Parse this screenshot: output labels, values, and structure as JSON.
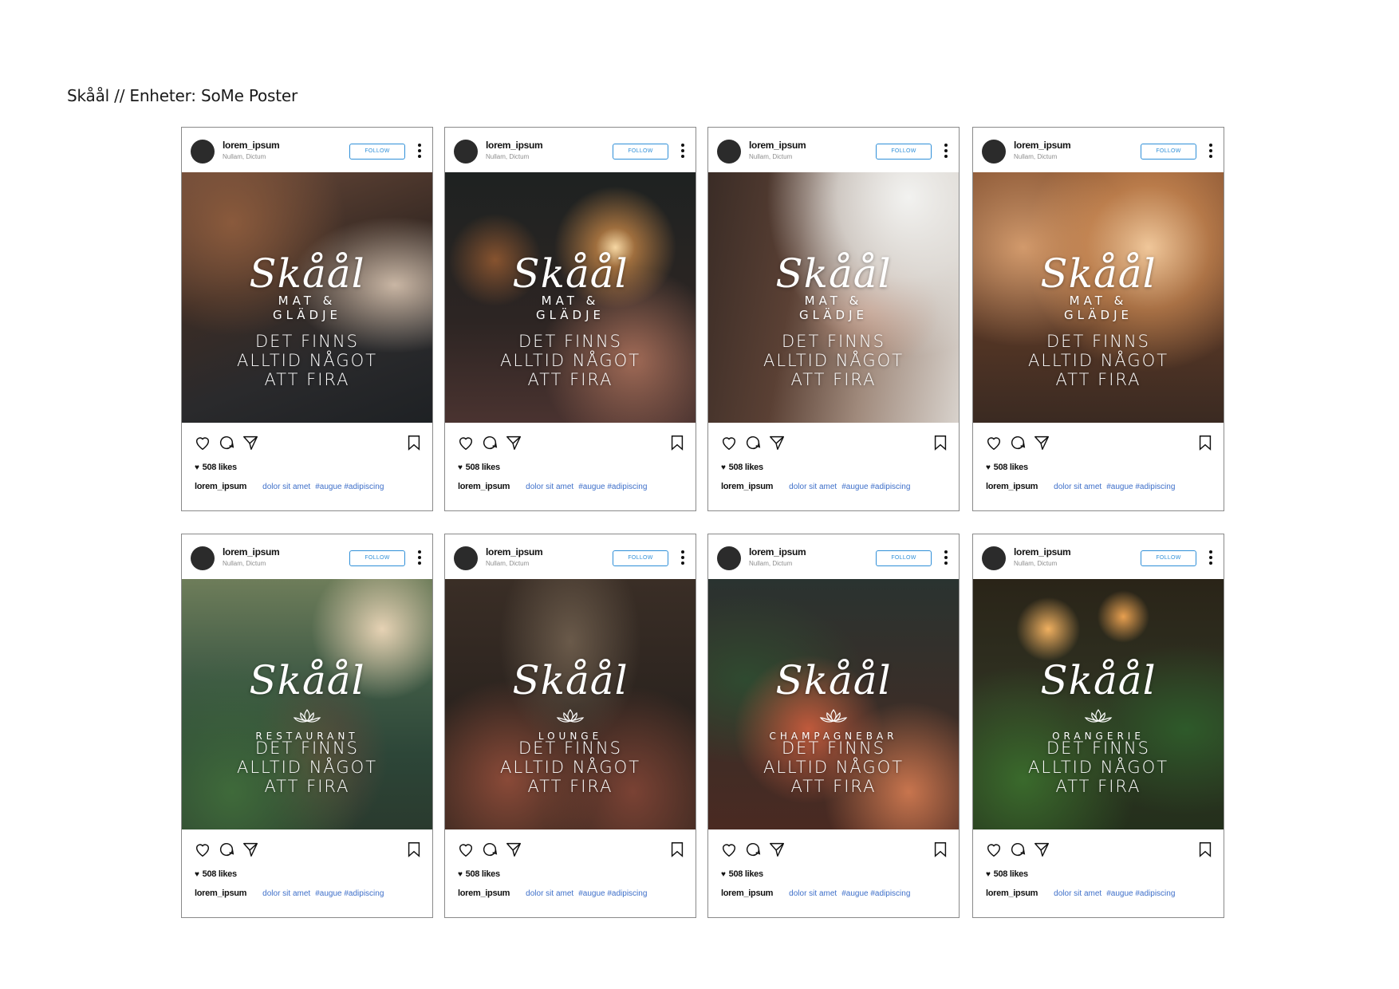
{
  "page": {
    "title": "Skåål // Enheter: SoMe Poster"
  },
  "post_common": {
    "username": "lorem_ipsum",
    "location": "Nullam, Dictum",
    "follow_label": "FOLLOW",
    "brand": "Skåål",
    "tagline_line1": "DET FINNS",
    "tagline_line2": "ALLTID NÅGOT",
    "tagline_line3": "ATT FIRA",
    "likes": "508 likes",
    "caption_user": "lorem_ipsum",
    "caption_text": "dolor sit amet",
    "caption_hashtags": "#augue #adipiscing"
  },
  "posts": [
    {
      "subtitle_line1": "MAT &",
      "subtitle_line2": "GLÄDJE"
    },
    {
      "subtitle_line1": "MAT &",
      "subtitle_line2": "GLÄDJE"
    },
    {
      "subtitle_line1": "MAT &",
      "subtitle_line2": "GLÄDJE"
    },
    {
      "subtitle_line1": "MAT &",
      "subtitle_line2": "GLÄDJE"
    },
    {
      "subtitle_line1": "RESTAURANT",
      "subtitle_line2": ""
    },
    {
      "subtitle_line1": "LOUNGE",
      "subtitle_line2": ""
    },
    {
      "subtitle_line1": "CHAMPAGNEBAR",
      "subtitle_line2": ""
    },
    {
      "subtitle_line1": "ORANGERIE",
      "subtitle_line2": ""
    }
  ],
  "icons": [
    "heart-icon",
    "comment-icon",
    "share-icon",
    "bookmark-icon",
    "more-options-icon"
  ],
  "colors": {
    "follow_blue": "#2f8fd8",
    "hashtag_blue": "#3e6fc9",
    "avatar": "#2b2b2b"
  }
}
